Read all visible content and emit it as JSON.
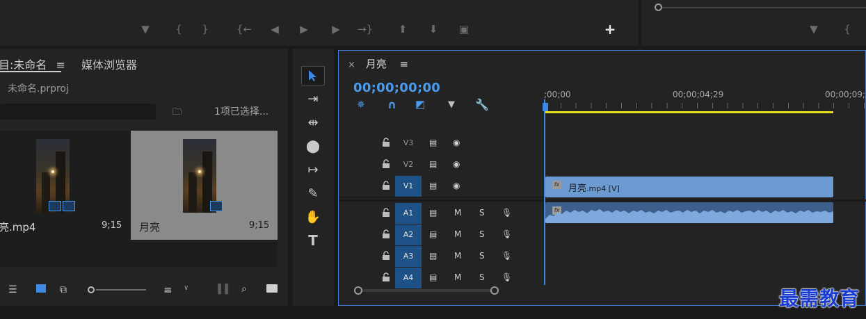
{
  "project_panel": {
    "tab_project": "目:未命名",
    "tab_menu_icon": "≡",
    "tab_media_browser": "媒体浏览器",
    "project_file": "未命名.prproj",
    "selection_status": "1项已选择...",
    "clips": [
      {
        "name": "亮.mp4",
        "duration": "9;15"
      },
      {
        "name": "月亮",
        "duration": "9;15"
      }
    ]
  },
  "timeline": {
    "sequence_name": "月亮",
    "close_icon": "×",
    "menu_icon": "≡",
    "timecode": "00;00;00;00",
    "ruler_labels": [
      ";00;00",
      "00;00;04;29",
      "00;00;09;"
    ],
    "tracks": [
      {
        "label": "V3",
        "type": "video",
        "target": false
      },
      {
        "label": "V2",
        "type": "video",
        "target": false
      },
      {
        "label": "V1",
        "type": "video",
        "target": true
      },
      {
        "label": "A1",
        "type": "audio",
        "target": true
      },
      {
        "label": "A2",
        "type": "audio",
        "target": true
      },
      {
        "label": "A3",
        "type": "audio",
        "target": true
      },
      {
        "label": "A4",
        "type": "audio",
        "target": true
      }
    ],
    "mute_label": "M",
    "solo_label": "S",
    "clip_v1_name": "月亮",
    "clip_v1_suffix": ".mp4 [V]",
    "fx_label": "fx"
  },
  "top_toolbar": {
    "add_label": "+"
  },
  "watermark": "最需教育",
  "colors": {
    "accent": "#3d8ae6",
    "target_track": "#1e5287",
    "video_clip": "#6c9bd2",
    "audio_clip": "#3c5f8c",
    "work_area": "#e5e01c"
  }
}
